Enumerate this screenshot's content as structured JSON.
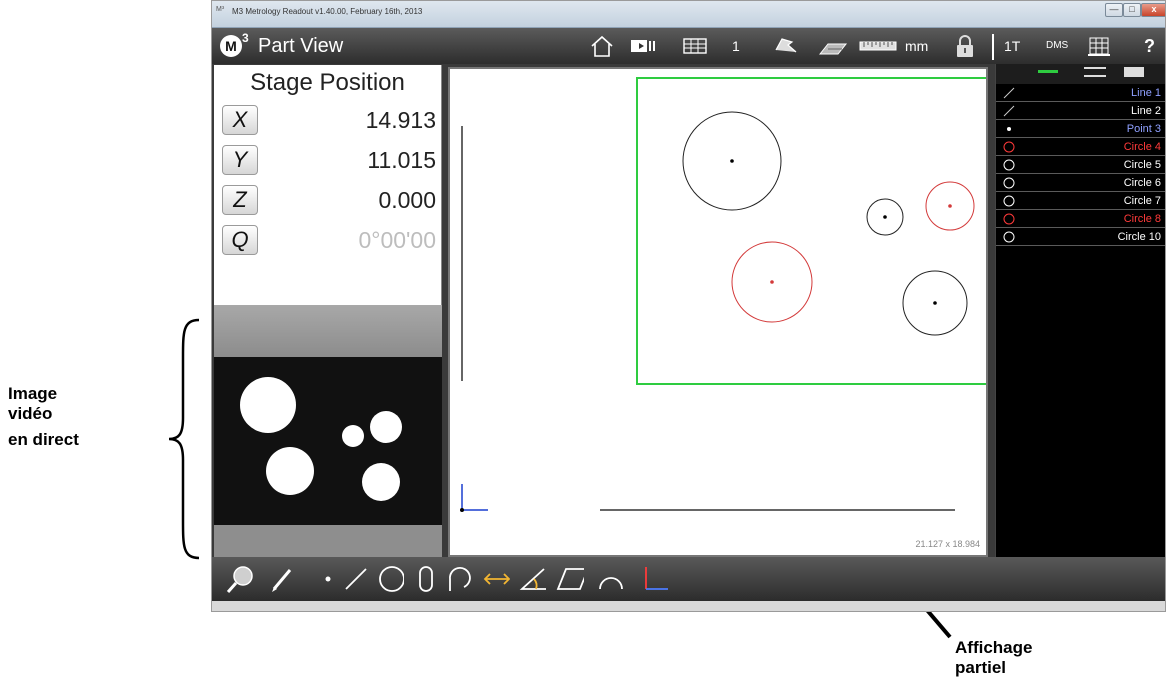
{
  "window": {
    "title": "M3 Metrology Readout  v1.40.00, February 16th, 2013",
    "app_icon_text": "M³",
    "minimize": "—",
    "maximize": "□",
    "close": "x"
  },
  "toolbar": {
    "logo": "M",
    "logo_sup": "3",
    "view_title": "Part View",
    "count": "1",
    "units": "mm",
    "tolerance": "1T",
    "angle_format": "DMS",
    "help": "?",
    "icons": [
      "home-icon",
      "video-camera-icon",
      "table-icon",
      "undo-icon",
      "eraser-icon",
      "ruler-icon",
      "lock-icon",
      "datum-icon",
      "help-icon"
    ]
  },
  "dro": {
    "title": "Stage Position",
    "axes": [
      {
        "label": "X",
        "value": "14.913"
      },
      {
        "label": "Y",
        "value": "11.015"
      },
      {
        "label": "Z",
        "value": "0.000"
      },
      {
        "label": "Q",
        "value": "0°00'00"
      }
    ]
  },
  "part_view": {
    "dimensions": "21.127 x 18.984"
  },
  "features": {
    "tab_icons": [
      "line-icon",
      "list-icon",
      "rectangle-icon"
    ],
    "items": [
      {
        "label": "Line 1",
        "type": "line",
        "color": "#8fa0ff"
      },
      {
        "label": "Line 2",
        "type": "line",
        "color": "#ffffff"
      },
      {
        "label": "Point 3",
        "type": "point",
        "color": "#8fa0ff"
      },
      {
        "label": "Circle 4",
        "type": "circle",
        "color": "#ff3a3a"
      },
      {
        "label": "Circle 5",
        "type": "circle",
        "color": "#ffffff"
      },
      {
        "label": "Circle 6",
        "type": "circle",
        "color": "#ffffff"
      },
      {
        "label": "Circle 7",
        "type": "circle",
        "color": "#ffffff"
      },
      {
        "label": "Circle 8",
        "type": "circle",
        "color": "#ff3a3a"
      },
      {
        "label": "Circle 10",
        "type": "circle",
        "color": "#ffffff"
      }
    ]
  },
  "bottom_toolbar": {
    "icons": [
      "magnifier-icon",
      "pen-icon",
      "point-icon",
      "line-icon",
      "circle-icon",
      "slot-icon",
      "arc-icon",
      "distance-icon",
      "angle-icon",
      "parallelogram-icon",
      "curve-icon",
      "skew-icon"
    ]
  },
  "annotations": {
    "left": [
      "Image",
      "vidéo",
      "en direct"
    ],
    "right": [
      "Affichage",
      "partiel"
    ]
  },
  "colors": {
    "accent_green": "#2ecc40",
    "feature_red": "#d33a3a",
    "feature_blue": "#8fa0ff"
  }
}
